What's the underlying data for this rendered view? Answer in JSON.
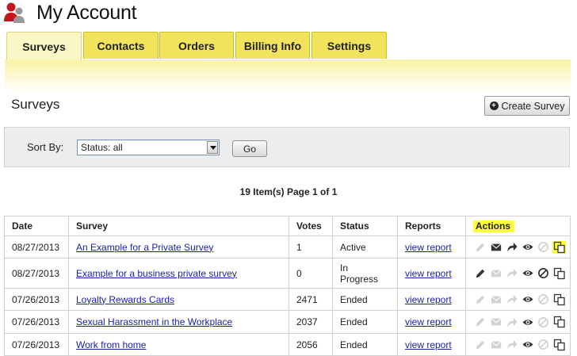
{
  "header": {
    "title": "My Account"
  },
  "tabs": [
    {
      "label": "Surveys",
      "active": true
    },
    {
      "label": "Contacts",
      "active": false
    },
    {
      "label": "Orders",
      "active": false
    },
    {
      "label": "Billing Info",
      "active": false
    },
    {
      "label": "Settings",
      "active": false
    }
  ],
  "section": {
    "title": "Surveys",
    "create_label": "Create Survey"
  },
  "sort": {
    "label": "Sort By:",
    "selected": "Status: all",
    "go_label": "Go"
  },
  "pager": {
    "count": "19",
    "items_text": " Item(s) Page ",
    "page": "1",
    "of_text": " of ",
    "total_pages": "1"
  },
  "table": {
    "headers": [
      "Date",
      "Survey",
      "Votes",
      "Status",
      "Reports",
      "Actions"
    ],
    "rows": [
      {
        "date": "08/27/2013",
        "survey": "An Example for a Private Survey",
        "votes": "1",
        "status": "Active",
        "report": "view report",
        "edit": false,
        "email": true,
        "forward": true,
        "stop": false
      },
      {
        "date": "08/27/2013",
        "survey": "Example for a business private survey",
        "votes": "0",
        "status_line1": "In",
        "status_line2": "Progress",
        "report": "view report",
        "edit": true,
        "email": false,
        "forward": false,
        "stop": true
      },
      {
        "date": "07/26/2013",
        "survey": "Loyalty Rewards Cards",
        "votes": "2471",
        "status": "Ended",
        "report": "view report",
        "edit": false,
        "email": false,
        "forward": false,
        "stop": false
      },
      {
        "date": "07/26/2013",
        "survey": "Sexual Harassment in the Workplace",
        "votes": "2037",
        "status": "Ended",
        "report": "view report",
        "edit": false,
        "email": false,
        "forward": false,
        "stop": false
      },
      {
        "date": "07/26/2013",
        "survey": "Work from home",
        "votes": "2056",
        "status": "Ended",
        "report": "view report",
        "edit": false,
        "email": false,
        "forward": false,
        "stop": false
      }
    ]
  },
  "colors": {
    "tab_yellow": "#f1e35b",
    "highlight": "#ffff3a",
    "link": "#1a22a8",
    "icon_active": "#333333",
    "icon_disabled": "#d2d2d2"
  }
}
